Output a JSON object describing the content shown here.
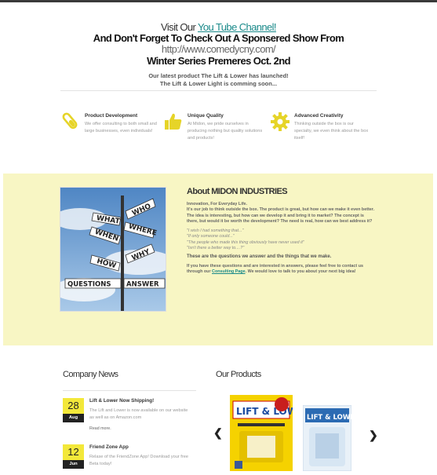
{
  "hero": {
    "line1_prefix": "Visit Our ",
    "line1_link": "You Tube Channel!",
    "line2": "And Don't Forget To Check Out A Sponsered Show From",
    "line3": "http://www.comedycny.com/",
    "line4": "Winter Series Premeres Oct. 2nd",
    "line5a": "Our latest product The Lift & Lower has launched!",
    "line5b": "The Lift & Lower Light is comming soon..."
  },
  "features": [
    {
      "icon": "test-tube-icon",
      "title": "Product Development",
      "desc": "We offer consulting to both small and large businesses, even individuals!"
    },
    {
      "icon": "thumbs-up-icon",
      "title": "Unique Quality",
      "desc": "At Midon, we pride ourselves in producing nothing but quality solutions and products!"
    },
    {
      "icon": "gear-icon",
      "title": "Advanced Creativity",
      "desc": "Thinking outside the box is our specialty, we even think about the box itself!"
    }
  ],
  "about": {
    "title": "About MIDON INDUSTRIES",
    "tagline": "Innovation, For Everyday Life.",
    "para1": "It's our job to think outside the box.  The product is great, but how can we make it even better.  The idea is interesting, but how can we develop it and bring it to market?  The concept is there, but would it be worth the development?  The need is real, how can we best address it?",
    "q1": "\"I wish I had something that...\"",
    "q2": "\"If only someone could...\"",
    "q3": "\"The people who made this thing obviously have never used it\"",
    "q4": "\"Isn't there a better way to....?\"",
    "para2": "These are the questions we answer and the things that we make.",
    "para3_prefix": "If you have these questions and are interested in answers, please feel free to contact us through our ",
    "para3_link": "Consulting Page",
    "para3_suffix": ". We would love to talk to you about your next big idea!",
    "signs": [
      "WHO",
      "WHAT",
      "WHERE",
      "WHEN",
      "WHY",
      "HOW",
      "QUESTIONS",
      "ANSWER"
    ]
  },
  "news": {
    "title": "Company News",
    "items": [
      {
        "day": "28",
        "month": "Aug",
        "title": "Lift & Lower Now Shipping!",
        "desc": "The Lift and Lower is now available on our website as well as on Amazon.com",
        "more": "Read more."
      },
      {
        "day": "12",
        "month": "Jun",
        "title": "Friend Zone App",
        "desc": "Relase of the FriendZone App!  Download your free Beta today!",
        "more": ""
      }
    ]
  },
  "products": {
    "title": "Our Products",
    "prev_icon": "chevron-left-icon",
    "next_icon": "chevron-right-icon",
    "item1_text": "LIFT & LOWER",
    "item2_text": "LIFT & LOWER"
  },
  "colors": {
    "accent": "#1a8a8a",
    "yellow": "#f3e83a",
    "band": "#f8f6c4"
  }
}
